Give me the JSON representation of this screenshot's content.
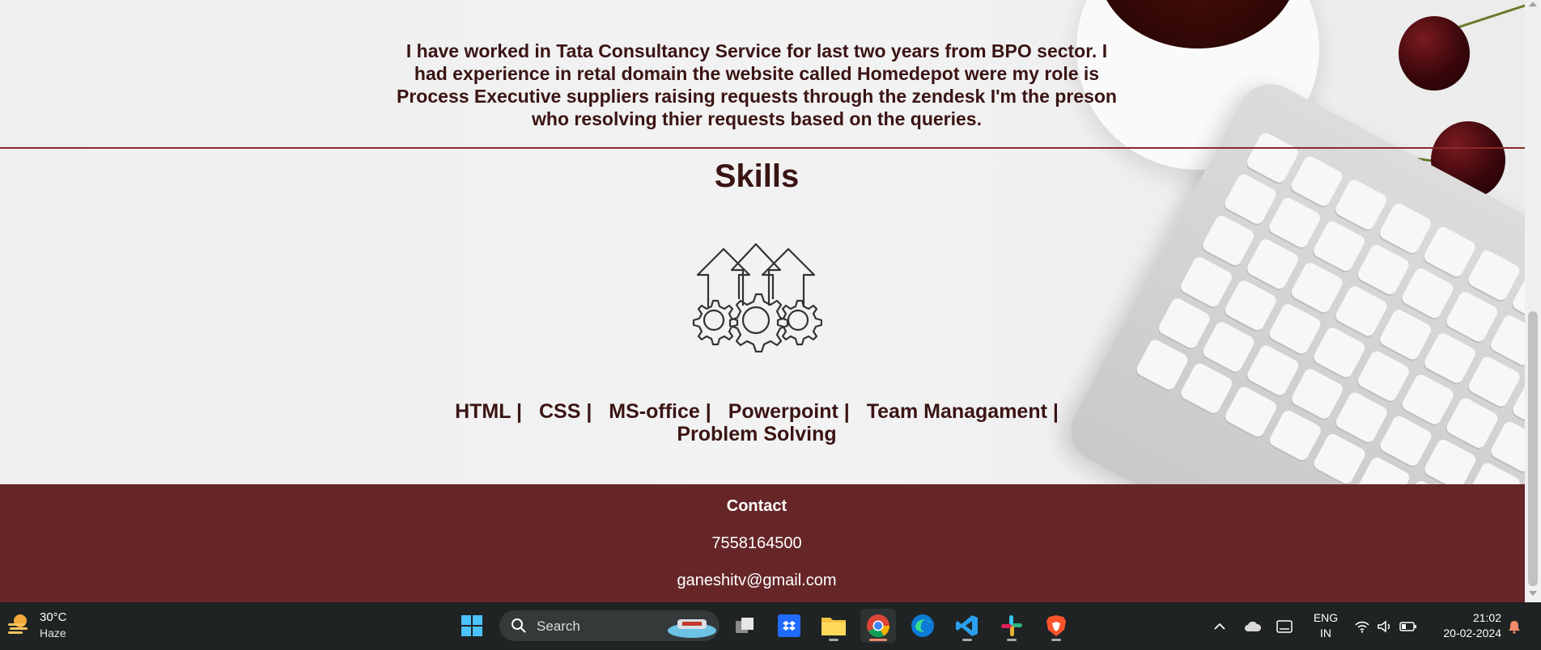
{
  "about": {
    "text": "I have worked in Tata Consultancy Service for last two years from BPO sector. I had experience in retal domain the website called Homedepot were my role is Process Executive suppliers raising requests through the zendesk I'm the preson who resolving thier requests based on the queries."
  },
  "skills": {
    "title": "Skills",
    "items": [
      "HTML |",
      "CSS |",
      "MS-office |",
      "Powerpoint |",
      "Team Managament |",
      "Problem Solving"
    ]
  },
  "contact": {
    "title": "Contact",
    "phone": "7558164500",
    "email": "ganeshitv@gmail.com"
  },
  "colors": {
    "accent": "#662628",
    "text": "#3b1414",
    "divider": "#8a2a2a"
  },
  "taskbar": {
    "weather": {
      "temp": "30°C",
      "condition": "Haze",
      "icon": "weather-haze-icon"
    },
    "search_placeholder": "Search",
    "apps": [
      "start-icon",
      "task-view-icon",
      "dropbox-icon",
      "file-explorer-icon",
      "chrome-icon",
      "edge-icon",
      "vscode-icon",
      "slack-icon",
      "brave-icon"
    ],
    "tray": {
      "lang_line1": "ENG",
      "lang_line2": "IN",
      "time": "21:02",
      "date": "20-02-2024"
    }
  }
}
